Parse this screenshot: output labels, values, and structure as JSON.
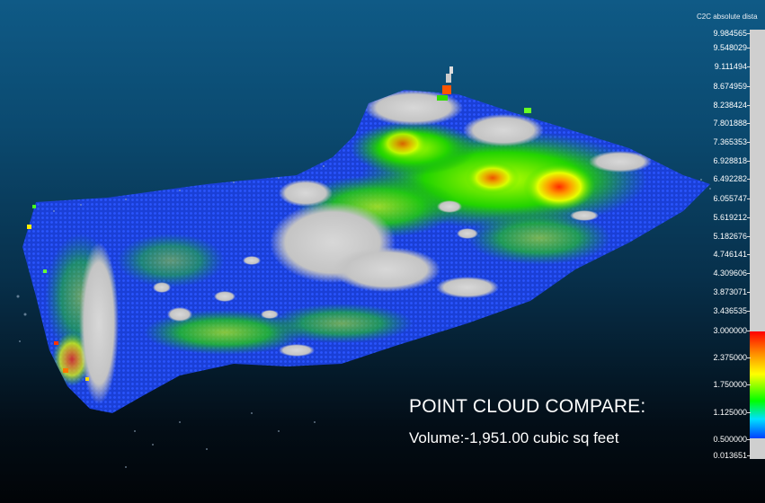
{
  "scale": {
    "title": "C2C absolute dista",
    "ticks": [
      "9.984565",
      "9.548029",
      "9.111494",
      "8.674959",
      "8.238424",
      "7.801888",
      "7.365353",
      "6.928818",
      "6.492282",
      "6.055747",
      "5.619212",
      "5.182676",
      "4.746141",
      "4.309606",
      "3.873071",
      "3.436535",
      "3.000000",
      "2.375000",
      "1.750000",
      "1.125000",
      "0.500000",
      "0.013651"
    ],
    "colors": {
      "high": "#ff0000",
      "mid_high": "#ff8800",
      "mid": "#ffff00",
      "mid_low": "#00ff00",
      "low": "#0040ff",
      "out_of_range": "#cfcfcf"
    }
  },
  "overlay": {
    "title": "POINT CLOUD COMPARE:",
    "volume": "Volume:-1,951.00 cubic sq feet"
  }
}
